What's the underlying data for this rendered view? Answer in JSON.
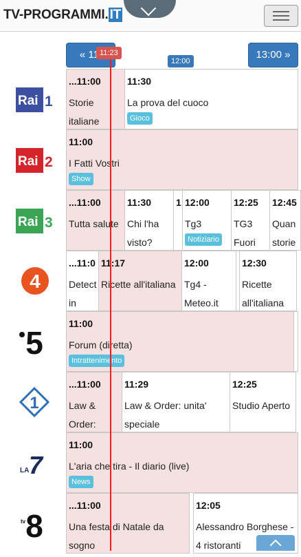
{
  "header": {
    "logo_main": "TV-PROGRAMMI.",
    "logo_tld": "IT"
  },
  "nav": {
    "prev_label": "« 11:",
    "next_label": "13:00 »",
    "now_time": "11:23",
    "time_marker": "12:00"
  },
  "channels": [
    {
      "name": "Rai 1",
      "programs": [
        {
          "time": "...11:00",
          "title": "Storie italiane",
          "tag": ""
        },
        {
          "time": "11:30",
          "title": "La prova del cuoco",
          "tag": "Gioco"
        }
      ]
    },
    {
      "name": "Rai 2",
      "programs": [
        {
          "time": "11:00",
          "title": "I Fatti Vostri",
          "tag": "Show"
        }
      ]
    },
    {
      "name": "Rai 3",
      "programs": [
        {
          "time": "...11:00",
          "title": "Tutta salute",
          "tag": ""
        },
        {
          "time": "11:30",
          "title": "Chi l'ha visto?",
          "tag": ""
        },
        {
          "time": "1",
          "title": "",
          "tag": ""
        },
        {
          "time": "12:00",
          "title": "Tg3",
          "tag": "Notiziario"
        },
        {
          "time": "12:25",
          "title": "TG3 Fuori",
          "tag": ""
        },
        {
          "time": "12:45",
          "title": "Quan storie",
          "tag": ""
        }
      ]
    },
    {
      "name": "Rete 4",
      "programs": [
        {
          "time": "...11:0",
          "title": "Detect in",
          "tag": ""
        },
        {
          "time": "11:17",
          "title": "Ricette all'italiana",
          "tag": ""
        },
        {
          "time": "12:00",
          "title": "Tg4 - Meteo.it",
          "tag": ""
        },
        {
          "time": "",
          "title": "",
          "tag": ""
        },
        {
          "time": "12:30",
          "title": "Ricette all'italiana",
          "tag": ""
        }
      ]
    },
    {
      "name": "Canale 5",
      "programs": [
        {
          "time": "11:00",
          "title": "Forum (diretta)",
          "tag": "Intrattenimento"
        }
      ]
    },
    {
      "name": "Italia 1",
      "programs": [
        {
          "time": "...11:00",
          "title": "Law & Order:",
          "tag": ""
        },
        {
          "time": "11:29",
          "title": "Law & Order: unita' speciale",
          "tag": ""
        },
        {
          "time": "12:25",
          "title": "Studio Aperto",
          "tag": ""
        }
      ]
    },
    {
      "name": "La7",
      "programs": [
        {
          "time": "11:00",
          "title": "L'aria che tira - Il diario (live)",
          "tag": "News"
        }
      ]
    },
    {
      "name": "TV8",
      "programs": [
        {
          "time": "...11:00",
          "title": "Una festa di Natale da sogno",
          "tag": ""
        },
        {
          "time": "12:05",
          "title": "Alessandro Borghese - 4 ristoranti",
          "tag": ""
        }
      ]
    }
  ],
  "logos": {
    "rai1": {
      "word": "Rai",
      "num": "1"
    },
    "rai2": {
      "word": "Rai",
      "num": "2"
    },
    "rai3": {
      "word": "Rai",
      "num": "3"
    },
    "rete4": {
      "num": "4"
    },
    "canale5": {
      "num": "5"
    },
    "italia1": {
      "num": "1"
    },
    "la7": {
      "word": "LA",
      "num": "7"
    },
    "tv8": {
      "word": "tv",
      "num": "8"
    }
  },
  "colors": {
    "accent": "#3779bb",
    "now": "#ff1a1a",
    "past_bg": "#f5e1e1",
    "tag": "#5bc0de",
    "rai1": "#3c4fa0",
    "rai2": "#d6242b",
    "rai3": "#3aa655",
    "rete4": "#e8531f"
  }
}
